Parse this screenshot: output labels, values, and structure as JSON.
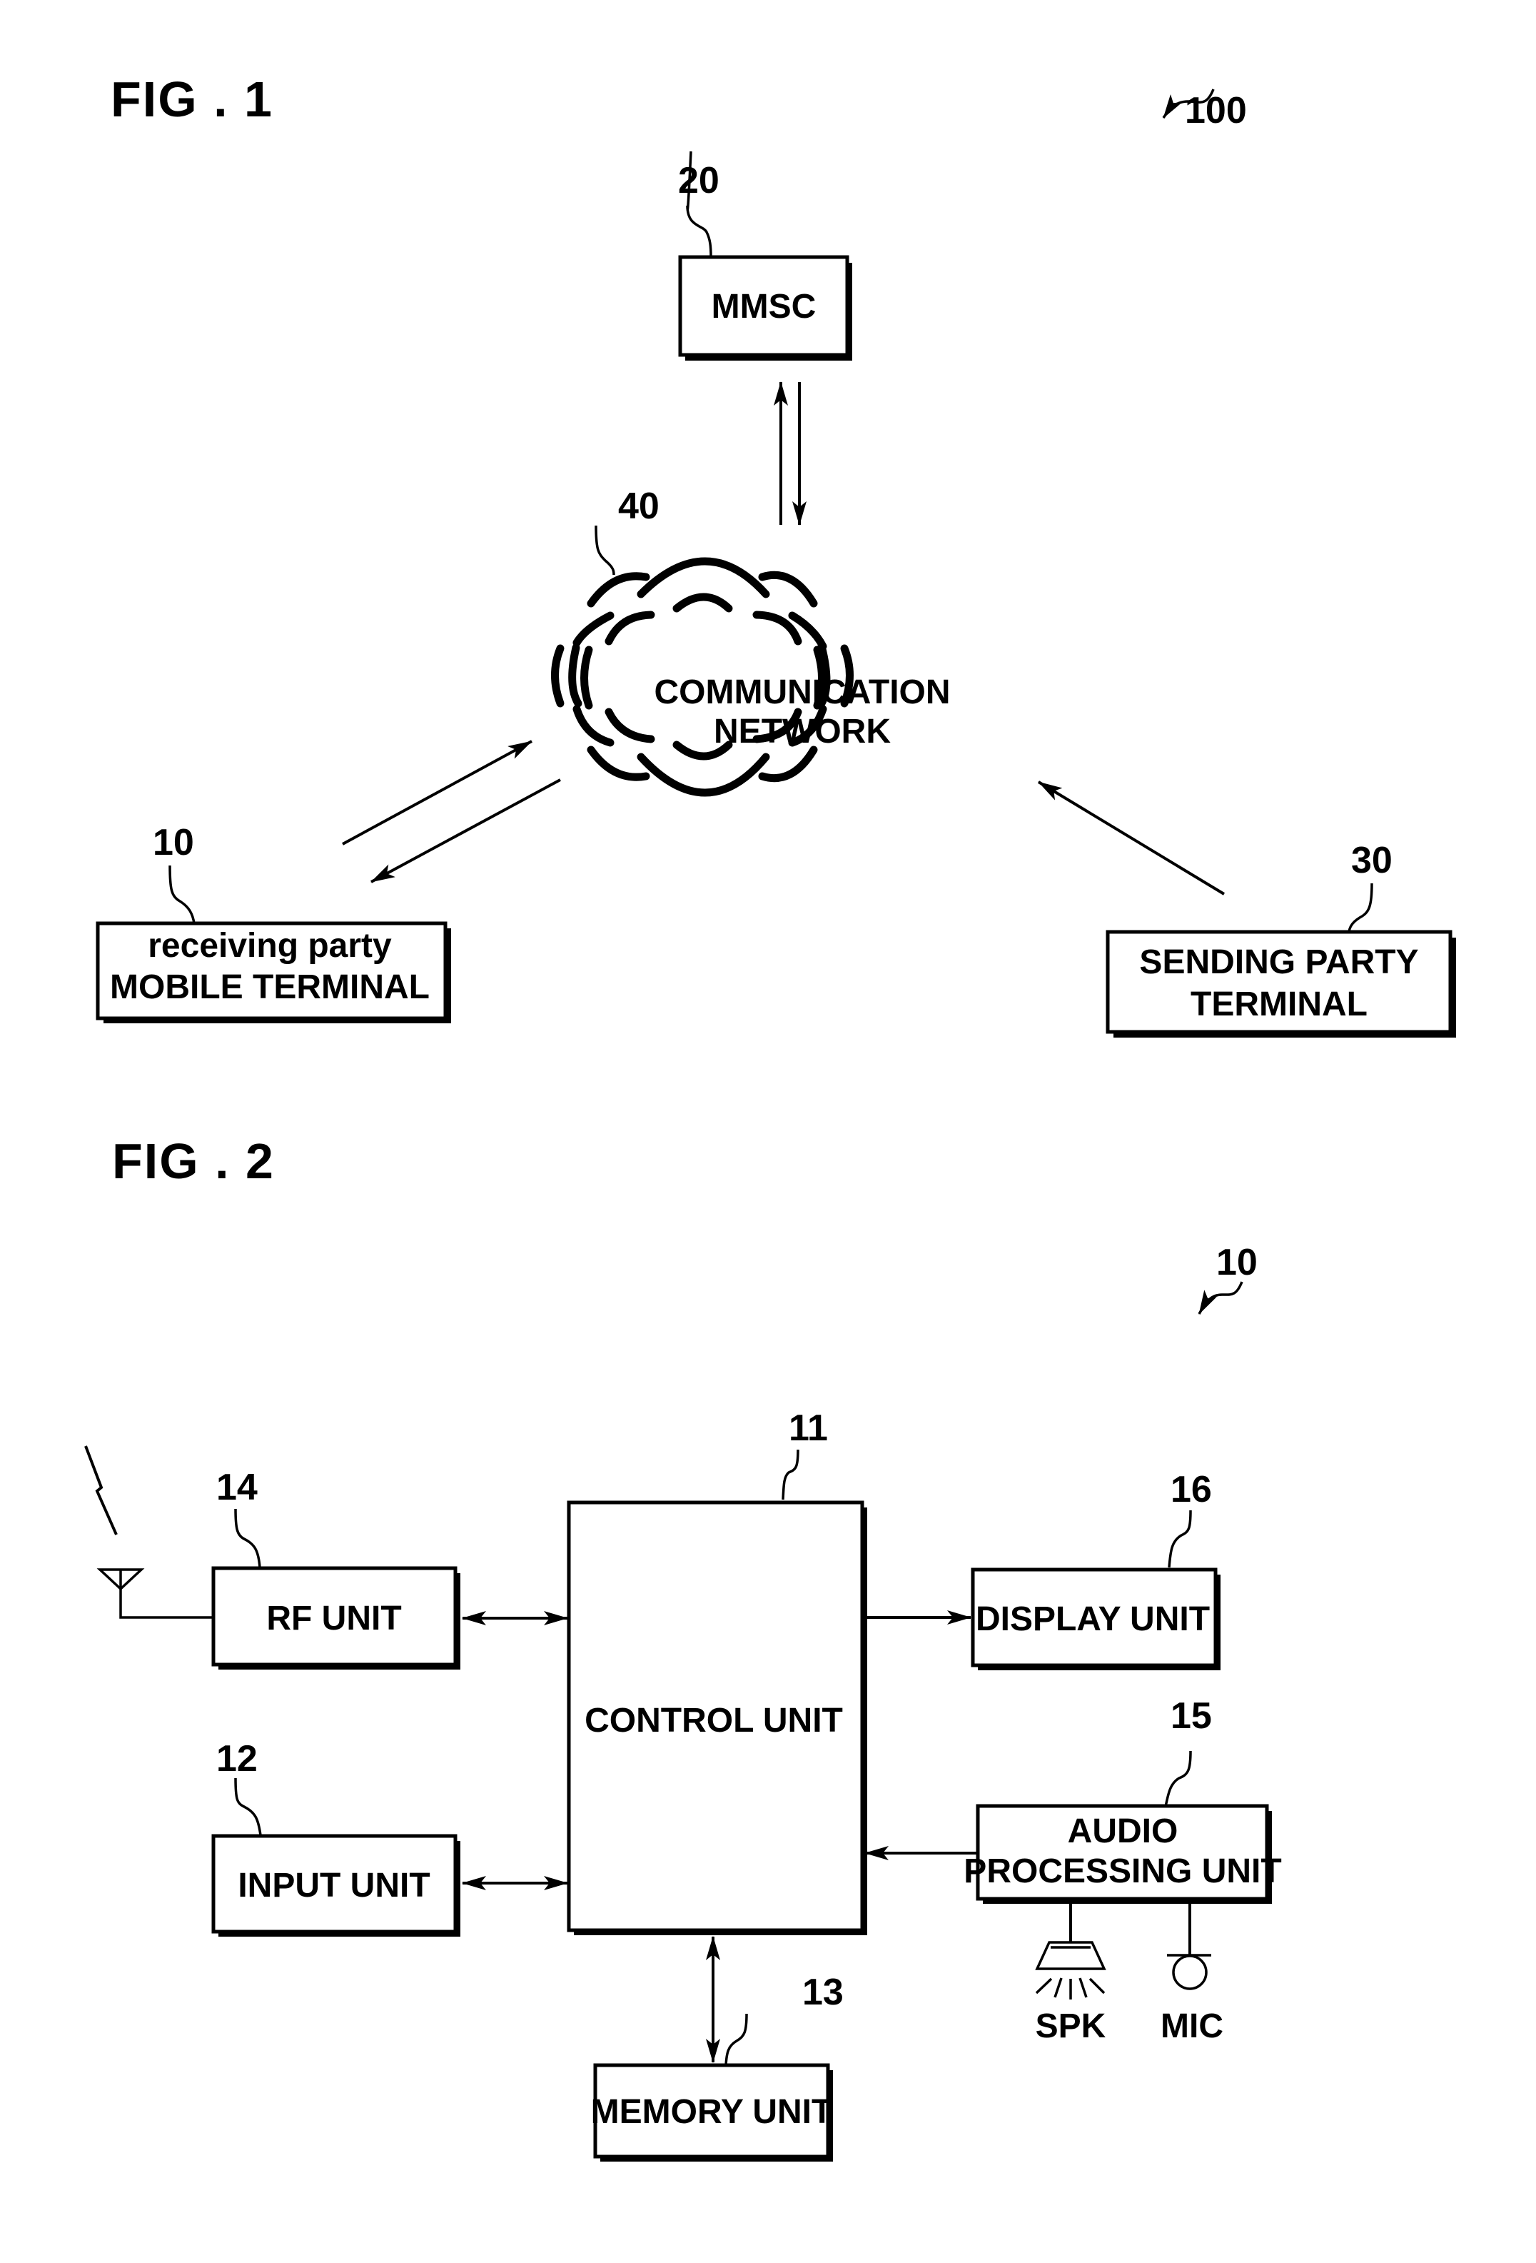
{
  "figure1": {
    "title": "FIG . 1",
    "system_ref": "100",
    "mmsc": {
      "ref": "20",
      "label": "MMSC"
    },
    "network": {
      "ref": "40",
      "label_line1": "COMMUNICATION",
      "label_line2": "NETWORK"
    },
    "receiving": {
      "ref": "10",
      "label_line1": "receiving party",
      "label_line2": "MOBILE TERMINAL"
    },
    "sending": {
      "ref": "30",
      "label_line1": "SENDING PARTY",
      "label_line2": "TERMINAL"
    }
  },
  "figure2": {
    "title": "FIG . 2",
    "device_ref": "10",
    "control": {
      "ref": "11",
      "label": "CONTROL UNIT"
    },
    "rf": {
      "ref": "14",
      "label": "RF UNIT"
    },
    "input": {
      "ref": "12",
      "label": "INPUT UNIT"
    },
    "display": {
      "ref": "16",
      "label": "DISPLAY UNIT"
    },
    "audio": {
      "ref": "15",
      "label_line1": "AUDIO",
      "label_line2": "PROCESSING UNIT"
    },
    "memory": {
      "ref": "13",
      "label": "MEMORY UNIT"
    },
    "speaker_label": "SPK",
    "mic_label": "MIC"
  }
}
